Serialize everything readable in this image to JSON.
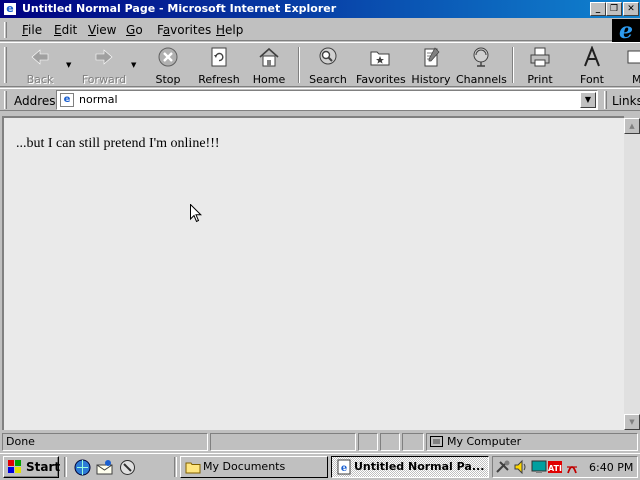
{
  "window": {
    "title": "Untitled Normal Page - Microsoft Internet Explorer",
    "minimize": "_",
    "maximize": "❐",
    "close": "✕"
  },
  "menu": {
    "file": {
      "key": "F",
      "rest": "ile"
    },
    "edit": {
      "key": "E",
      "rest": "dit"
    },
    "view": {
      "key": "V",
      "rest": "iew"
    },
    "go": {
      "key": "G",
      "rest": "o"
    },
    "favorites": {
      "pre": "F",
      "key": "a",
      "rest": "vorites"
    },
    "help": {
      "key": "H",
      "rest": "elp"
    }
  },
  "logo": "e",
  "toolbar": {
    "back": "Back",
    "forward": "Forward",
    "stop": "Stop",
    "refresh": "Refresh",
    "home": "Home",
    "search": "Search",
    "favorites": "Favorites",
    "history": "History",
    "channels": "Channels",
    "print": "Print",
    "font": "Font",
    "mail": "M"
  },
  "address": {
    "label": "Address",
    "value": "normal",
    "links": "Links"
  },
  "page": {
    "text": "...but I can still pretend I'm online!!!"
  },
  "status": {
    "text": "Done",
    "zone": "My Computer"
  },
  "taskbar": {
    "start": "Start",
    "tasks": [
      {
        "label": "My Documents"
      },
      {
        "label": "Untitled Normal Pa..."
      }
    ],
    "clock": "6:40 PM"
  },
  "colors": {
    "title_active_start": "#000080",
    "title_active_end": "#1084d0",
    "chrome": "#c0c0c0",
    "content_bg": "#eaeaea"
  }
}
